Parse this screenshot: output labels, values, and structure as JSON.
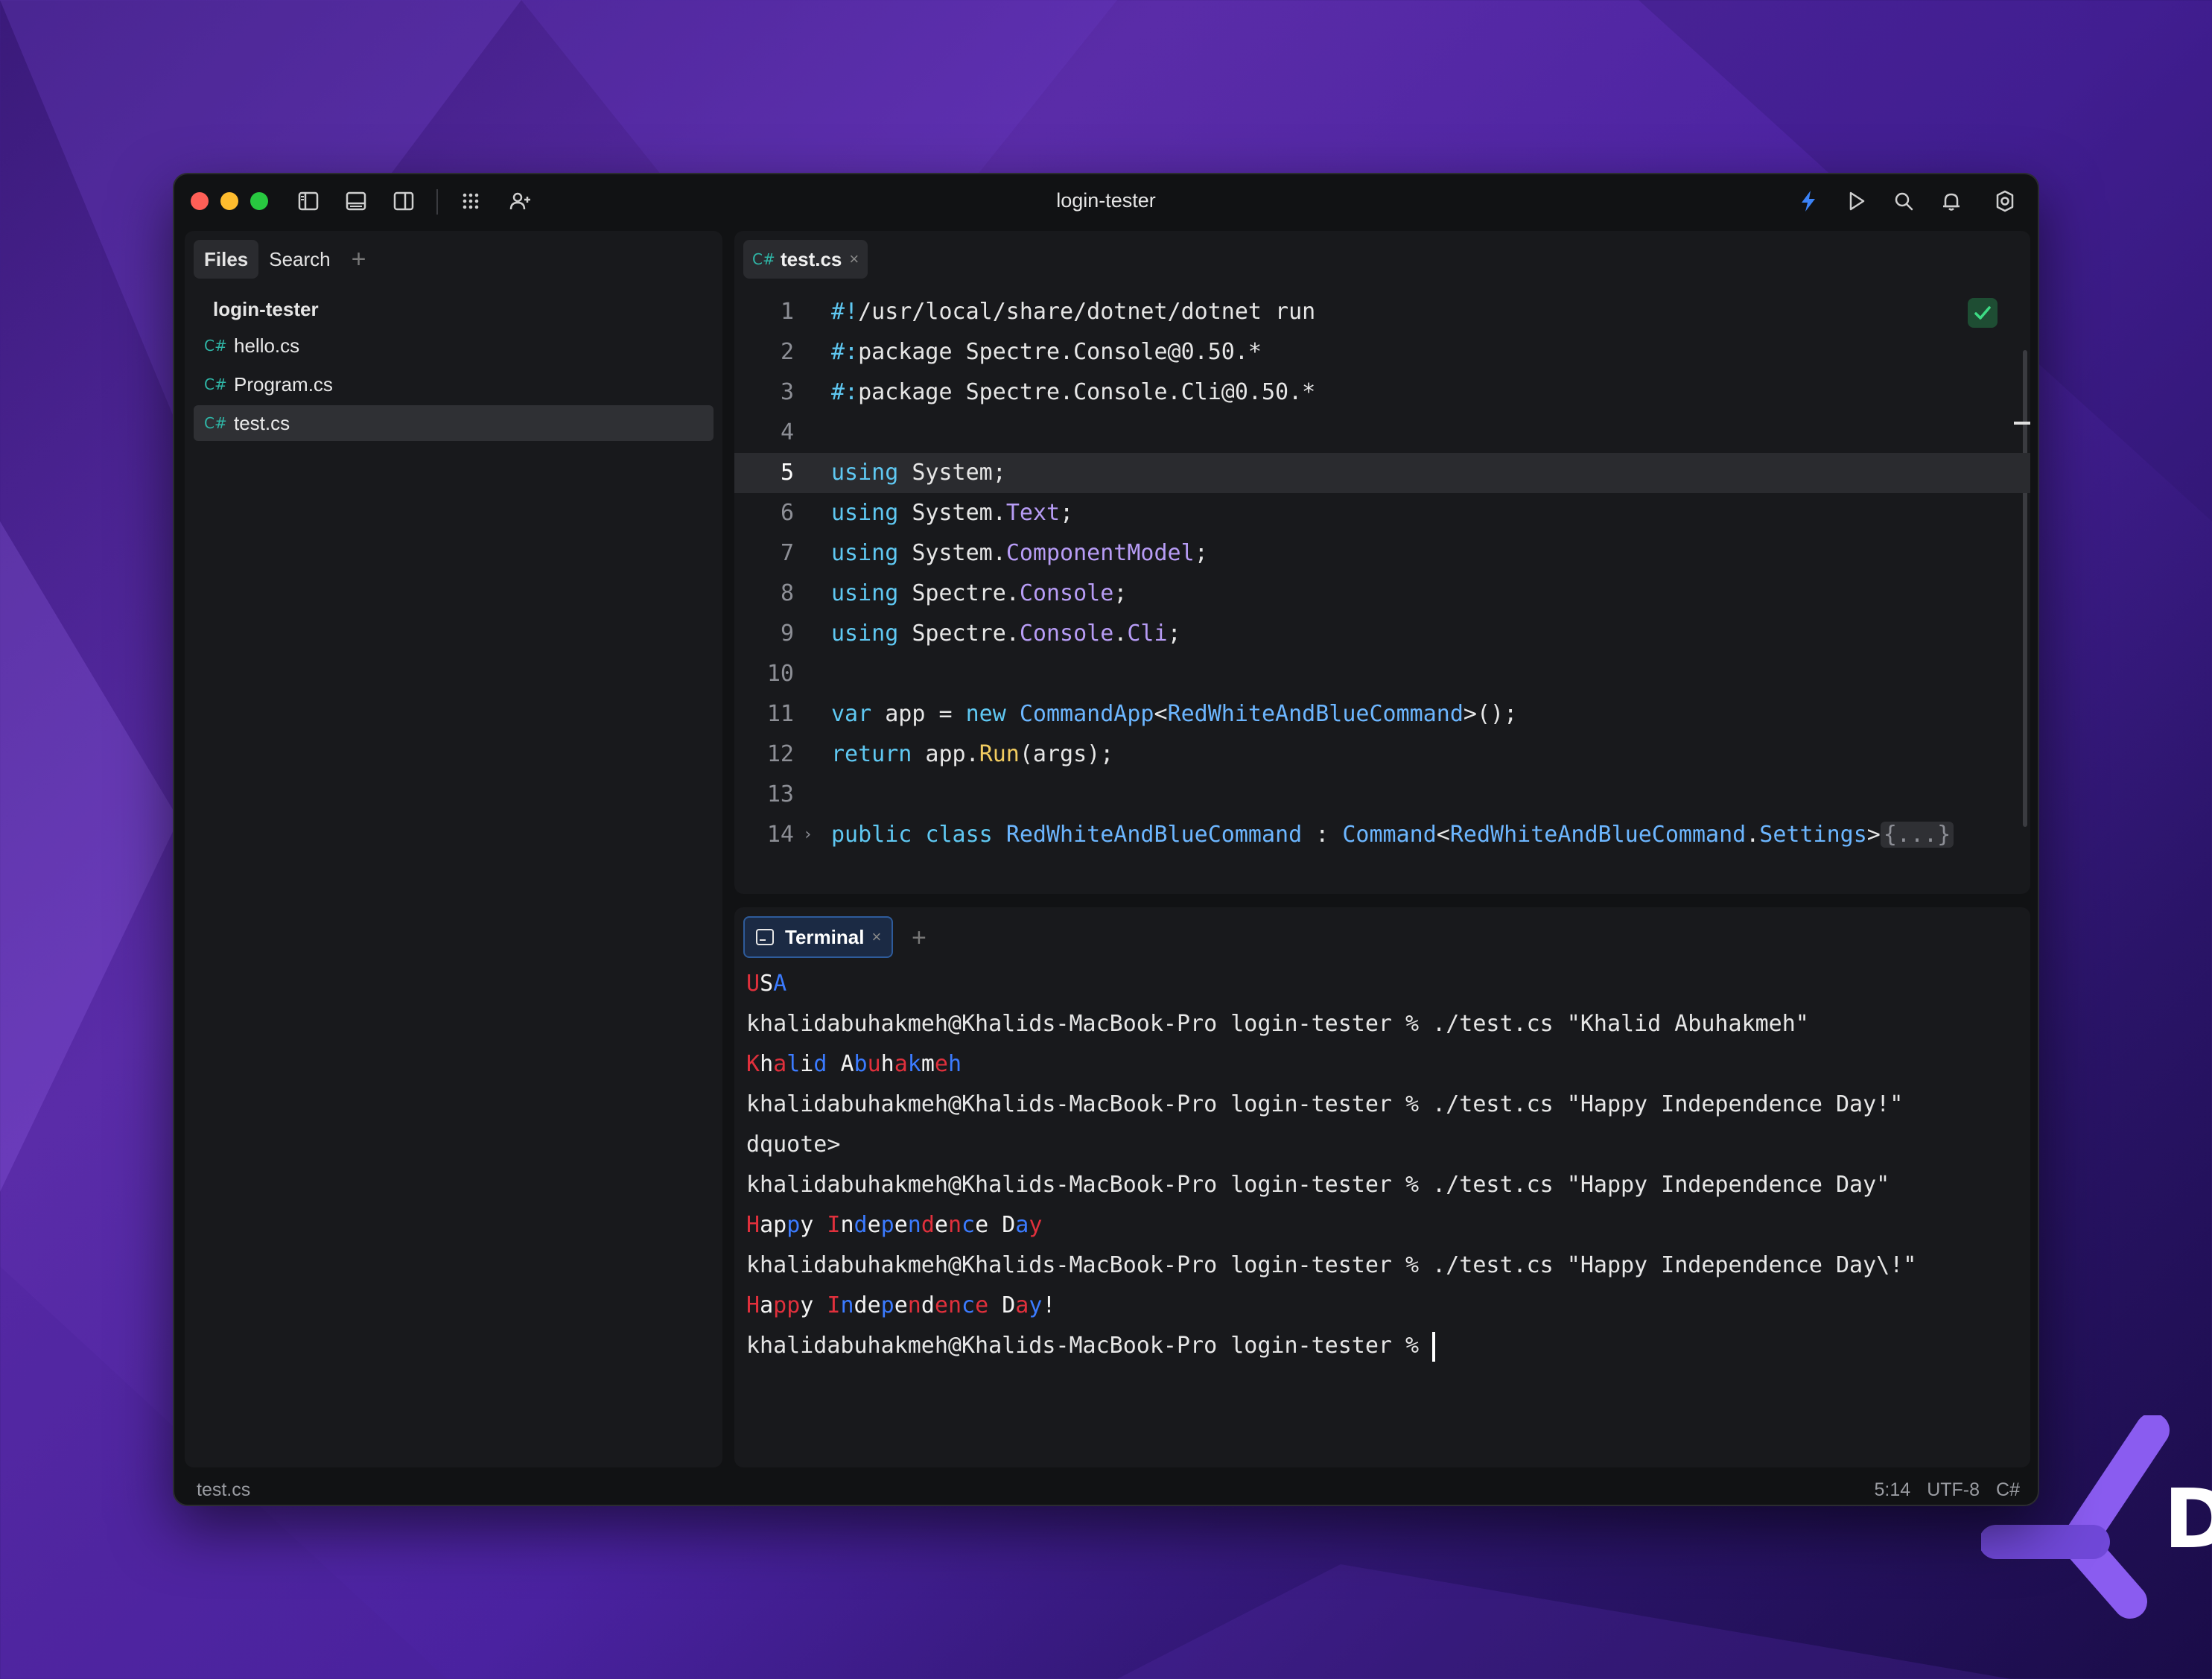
{
  "window": {
    "title": "login-tester"
  },
  "sidebar": {
    "tabs": [
      {
        "label": "Files"
      },
      {
        "label": "Search"
      }
    ],
    "add_label": "+",
    "project_name": "login-tester",
    "files": [
      {
        "icon": "C#",
        "name": "hello.cs"
      },
      {
        "icon": "C#",
        "name": "Program.cs"
      },
      {
        "icon": "C#",
        "name": "test.cs"
      }
    ]
  },
  "editor": {
    "tab": {
      "icon": "C#",
      "label": "test.cs",
      "close": "×"
    },
    "current_line": 5,
    "line_numbers": [
      "1",
      "2",
      "3",
      "4",
      "5",
      "6",
      "7",
      "8",
      "9",
      "10",
      "11",
      "12",
      "13",
      "14"
    ],
    "fold_marker": "›"
  },
  "terminal": {
    "tab": {
      "label": "Terminal",
      "close": "×"
    },
    "add_label": "+",
    "lines": {
      "l2": "khalidabuhakmeh@Khalids-MacBook-Pro login-tester % ./test.cs \"Khalid Abuhakmeh\"",
      "l4": "khalidabuhakmeh@Khalids-MacBook-Pro login-tester % ./test.cs \"Happy Independence Day!\"",
      "l5": "dquote>",
      "l6": "khalidabuhakmeh@Khalids-MacBook-Pro login-tester % ./test.cs \"Happy Independence Day\"",
      "l8": "khalidabuhakmeh@Khalids-MacBook-Pro login-tester % ./test.cs \"Happy Independence Day\\!\"",
      "l10": "khalidabuhakmeh@Khalids-MacBook-Pro login-tester % "
    }
  },
  "statusbar": {
    "file": "test.cs",
    "position": "5:14",
    "encoding": "UTF-8",
    "language": "C#"
  },
  "colors": {
    "accent": "#2e5b9a",
    "flag_red": "#e0303c",
    "flag_blue": "#3b7bff",
    "keyword": "#5fc8f2",
    "type": "#b79cf5"
  }
}
